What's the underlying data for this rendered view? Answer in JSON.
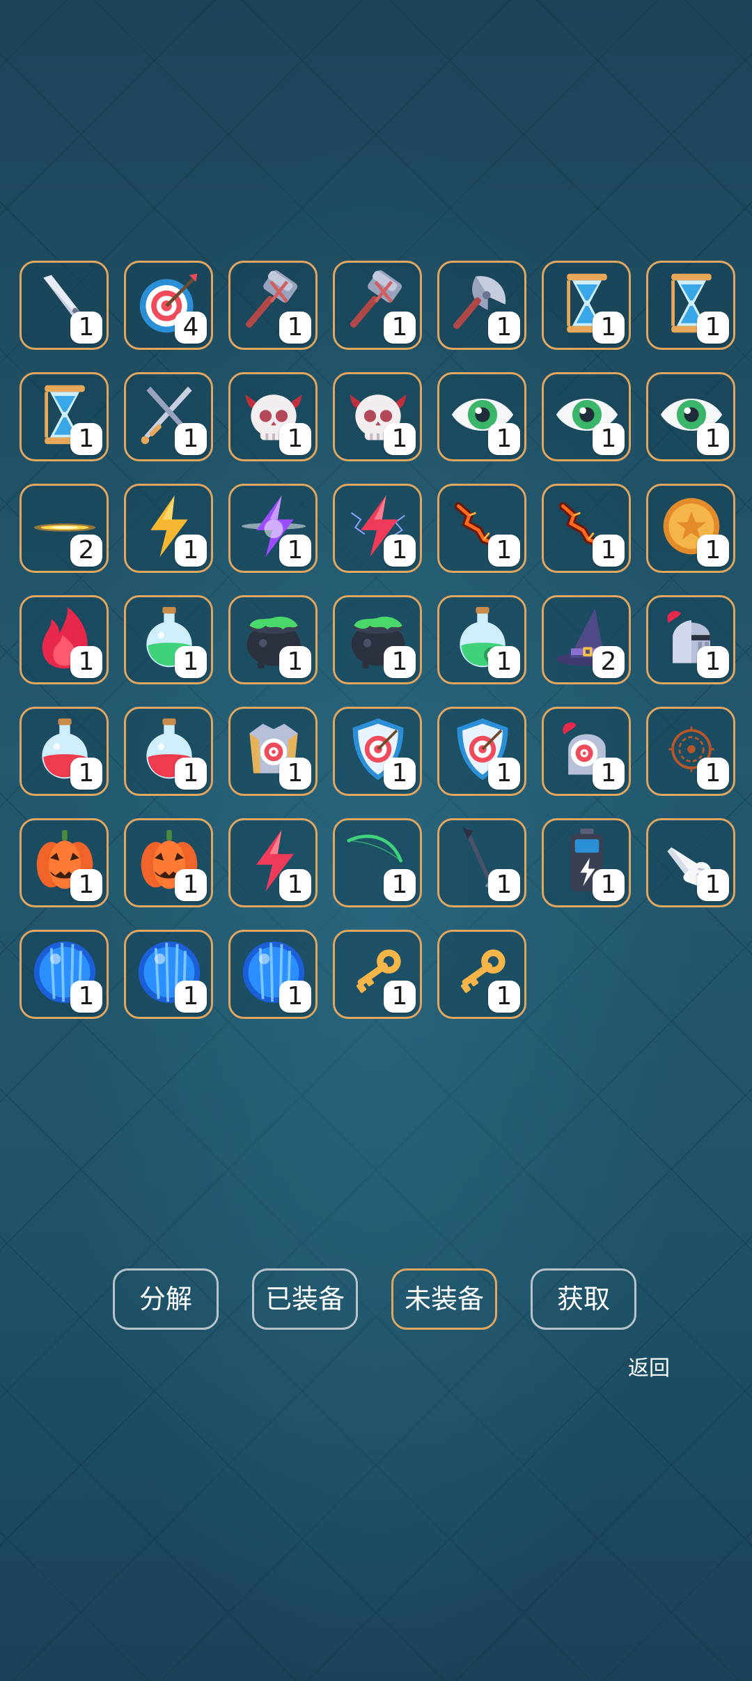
{
  "inventory": {
    "items": [
      {
        "icon": "sword-icon",
        "count": "1"
      },
      {
        "icon": "target-icon",
        "count": "4"
      },
      {
        "icon": "hammer-crossed-icon",
        "count": "1"
      },
      {
        "icon": "hammer-crossed-icon",
        "count": "1"
      },
      {
        "icon": "battle-axe-icon",
        "count": "1"
      },
      {
        "icon": "hourglass-icon",
        "count": "1"
      },
      {
        "icon": "hourglass-icon",
        "count": "1"
      },
      {
        "icon": "hourglass-icon",
        "count": "1"
      },
      {
        "icon": "crossed-swords-icon",
        "count": "1"
      },
      {
        "icon": "demon-skull-icon",
        "count": "1"
      },
      {
        "icon": "demon-skull-icon",
        "count": "1"
      },
      {
        "icon": "eye-icon",
        "count": "1"
      },
      {
        "icon": "eye-icon",
        "count": "1"
      },
      {
        "icon": "eye-icon",
        "count": "1"
      },
      {
        "icon": "fire-streak-icon",
        "count": "2"
      },
      {
        "icon": "lightning-yellow-icon",
        "count": "1"
      },
      {
        "icon": "lightning-purple-icon",
        "count": "1"
      },
      {
        "icon": "lightning-red-storm-icon",
        "count": "1"
      },
      {
        "icon": "lava-crack-icon",
        "count": "1"
      },
      {
        "icon": "lava-crack-icon",
        "count": "1"
      },
      {
        "icon": "gold-coin-icon",
        "count": "1"
      },
      {
        "icon": "flame-icon",
        "count": "1"
      },
      {
        "icon": "green-potion-icon",
        "count": "1"
      },
      {
        "icon": "cauldron-icon",
        "count": "1"
      },
      {
        "icon": "cauldron-icon",
        "count": "1"
      },
      {
        "icon": "green-potion-bubble-icon",
        "count": "1"
      },
      {
        "icon": "wizard-hat-icon",
        "count": "2"
      },
      {
        "icon": "knight-helmet-icon",
        "count": "1"
      },
      {
        "icon": "red-potion-icon",
        "count": "1"
      },
      {
        "icon": "red-potion-icon",
        "count": "1"
      },
      {
        "icon": "armor-target-icon",
        "count": "1"
      },
      {
        "icon": "shield-target-icon",
        "count": "1"
      },
      {
        "icon": "shield-target-icon",
        "count": "1"
      },
      {
        "icon": "helmet-target-icon",
        "count": "1"
      },
      {
        "icon": "rune-circle-icon",
        "count": "1"
      },
      {
        "icon": "pumpkin-icon",
        "count": "1"
      },
      {
        "icon": "pumpkin-icon",
        "count": "1"
      },
      {
        "icon": "lightning-red-icon",
        "count": "1"
      },
      {
        "icon": "green-bow-icon",
        "count": "1"
      },
      {
        "icon": "arrow-icon",
        "count": "1"
      },
      {
        "icon": "battery-icon",
        "count": "1"
      },
      {
        "icon": "pointing-glove-icon",
        "count": "1"
      },
      {
        "icon": "blue-orb-icon",
        "count": "1"
      },
      {
        "icon": "blue-orb-icon",
        "count": "1"
      },
      {
        "icon": "blue-orb-icon",
        "count": "1"
      },
      {
        "icon": "gold-key-icon",
        "count": "1"
      },
      {
        "icon": "gold-key-icon",
        "count": "1"
      }
    ]
  },
  "actions": {
    "decompose": "分解",
    "equipped": "已装备",
    "unequipped": "未装备",
    "obtain": "获取",
    "active": "unequipped"
  },
  "back_label": "返回",
  "colors": {
    "slot_border": "#e2a65e",
    "button_border": "#b9c4ca",
    "active_border": "#e2a65e",
    "background": "#1f5268"
  }
}
